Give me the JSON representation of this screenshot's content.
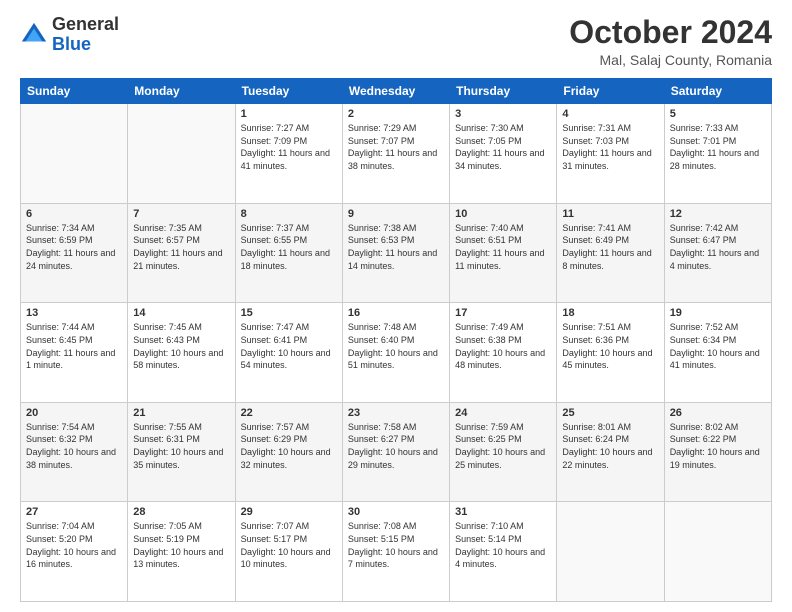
{
  "header": {
    "logo": {
      "line1": "General",
      "line2": "Blue"
    },
    "title": "October 2024",
    "location": "Mal, Salaj County, Romania"
  },
  "weekdays": [
    "Sunday",
    "Monday",
    "Tuesday",
    "Wednesday",
    "Thursday",
    "Friday",
    "Saturday"
  ],
  "weeks": [
    [
      {
        "day": "",
        "info": ""
      },
      {
        "day": "",
        "info": ""
      },
      {
        "day": "1",
        "info": "Sunrise: 7:27 AM\nSunset: 7:09 PM\nDaylight: 11 hours and 41 minutes."
      },
      {
        "day": "2",
        "info": "Sunrise: 7:29 AM\nSunset: 7:07 PM\nDaylight: 11 hours and 38 minutes."
      },
      {
        "day": "3",
        "info": "Sunrise: 7:30 AM\nSunset: 7:05 PM\nDaylight: 11 hours and 34 minutes."
      },
      {
        "day": "4",
        "info": "Sunrise: 7:31 AM\nSunset: 7:03 PM\nDaylight: 11 hours and 31 minutes."
      },
      {
        "day": "5",
        "info": "Sunrise: 7:33 AM\nSunset: 7:01 PM\nDaylight: 11 hours and 28 minutes."
      }
    ],
    [
      {
        "day": "6",
        "info": "Sunrise: 7:34 AM\nSunset: 6:59 PM\nDaylight: 11 hours and 24 minutes."
      },
      {
        "day": "7",
        "info": "Sunrise: 7:35 AM\nSunset: 6:57 PM\nDaylight: 11 hours and 21 minutes."
      },
      {
        "day": "8",
        "info": "Sunrise: 7:37 AM\nSunset: 6:55 PM\nDaylight: 11 hours and 18 minutes."
      },
      {
        "day": "9",
        "info": "Sunrise: 7:38 AM\nSunset: 6:53 PM\nDaylight: 11 hours and 14 minutes."
      },
      {
        "day": "10",
        "info": "Sunrise: 7:40 AM\nSunset: 6:51 PM\nDaylight: 11 hours and 11 minutes."
      },
      {
        "day": "11",
        "info": "Sunrise: 7:41 AM\nSunset: 6:49 PM\nDaylight: 11 hours and 8 minutes."
      },
      {
        "day": "12",
        "info": "Sunrise: 7:42 AM\nSunset: 6:47 PM\nDaylight: 11 hours and 4 minutes."
      }
    ],
    [
      {
        "day": "13",
        "info": "Sunrise: 7:44 AM\nSunset: 6:45 PM\nDaylight: 11 hours and 1 minute."
      },
      {
        "day": "14",
        "info": "Sunrise: 7:45 AM\nSunset: 6:43 PM\nDaylight: 10 hours and 58 minutes."
      },
      {
        "day": "15",
        "info": "Sunrise: 7:47 AM\nSunset: 6:41 PM\nDaylight: 10 hours and 54 minutes."
      },
      {
        "day": "16",
        "info": "Sunrise: 7:48 AM\nSunset: 6:40 PM\nDaylight: 10 hours and 51 minutes."
      },
      {
        "day": "17",
        "info": "Sunrise: 7:49 AM\nSunset: 6:38 PM\nDaylight: 10 hours and 48 minutes."
      },
      {
        "day": "18",
        "info": "Sunrise: 7:51 AM\nSunset: 6:36 PM\nDaylight: 10 hours and 45 minutes."
      },
      {
        "day": "19",
        "info": "Sunrise: 7:52 AM\nSunset: 6:34 PM\nDaylight: 10 hours and 41 minutes."
      }
    ],
    [
      {
        "day": "20",
        "info": "Sunrise: 7:54 AM\nSunset: 6:32 PM\nDaylight: 10 hours and 38 minutes."
      },
      {
        "day": "21",
        "info": "Sunrise: 7:55 AM\nSunset: 6:31 PM\nDaylight: 10 hours and 35 minutes."
      },
      {
        "day": "22",
        "info": "Sunrise: 7:57 AM\nSunset: 6:29 PM\nDaylight: 10 hours and 32 minutes."
      },
      {
        "day": "23",
        "info": "Sunrise: 7:58 AM\nSunset: 6:27 PM\nDaylight: 10 hours and 29 minutes."
      },
      {
        "day": "24",
        "info": "Sunrise: 7:59 AM\nSunset: 6:25 PM\nDaylight: 10 hours and 25 minutes."
      },
      {
        "day": "25",
        "info": "Sunrise: 8:01 AM\nSunset: 6:24 PM\nDaylight: 10 hours and 22 minutes."
      },
      {
        "day": "26",
        "info": "Sunrise: 8:02 AM\nSunset: 6:22 PM\nDaylight: 10 hours and 19 minutes."
      }
    ],
    [
      {
        "day": "27",
        "info": "Sunrise: 7:04 AM\nSunset: 5:20 PM\nDaylight: 10 hours and 16 minutes."
      },
      {
        "day": "28",
        "info": "Sunrise: 7:05 AM\nSunset: 5:19 PM\nDaylight: 10 hours and 13 minutes."
      },
      {
        "day": "29",
        "info": "Sunrise: 7:07 AM\nSunset: 5:17 PM\nDaylight: 10 hours and 10 minutes."
      },
      {
        "day": "30",
        "info": "Sunrise: 7:08 AM\nSunset: 5:15 PM\nDaylight: 10 hours and 7 minutes."
      },
      {
        "day": "31",
        "info": "Sunrise: 7:10 AM\nSunset: 5:14 PM\nDaylight: 10 hours and 4 minutes."
      },
      {
        "day": "",
        "info": ""
      },
      {
        "day": "",
        "info": ""
      }
    ]
  ]
}
